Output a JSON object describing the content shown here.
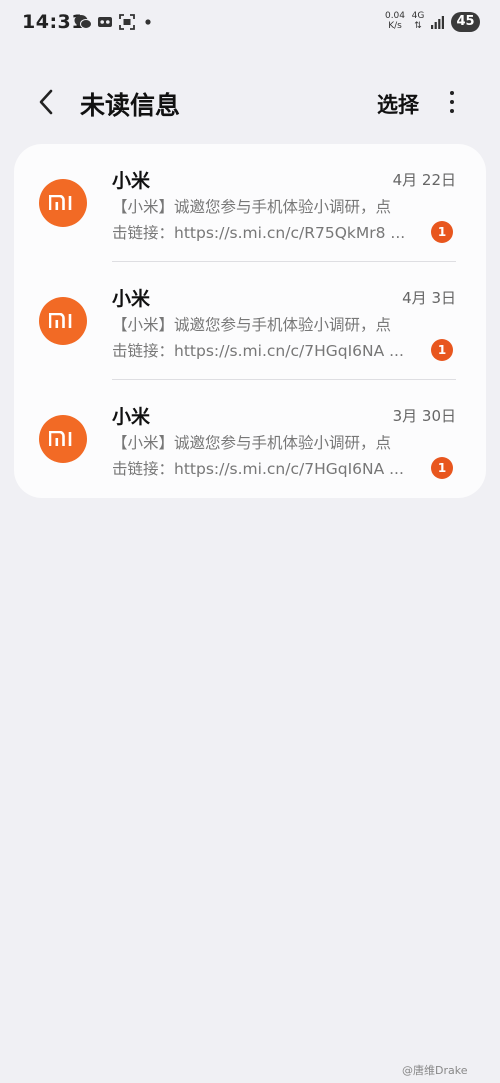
{
  "status_bar": {
    "time": "14:31",
    "icons": [
      "wechat-icon",
      "voicemail-icon",
      "screenshot-icon",
      "dot-icon",
      "signal-icon"
    ],
    "speed_value": "0.04",
    "speed_unit": "K/s",
    "network": "4G",
    "battery": "45"
  },
  "header": {
    "back_icon": "chevron-left-icon",
    "title": "未读信息",
    "select_label": "选择",
    "more_icon": "more-vertical-icon"
  },
  "brand_color": "#f26a25",
  "badge_color": "#e8561e",
  "messages": [
    {
      "sender": "小米",
      "date": "4月 22日",
      "preview_line1": "【小米】诚邀您参与手机体验小调研，点",
      "preview_line2": "击链接：https://s.mi.cn/c/R75QkMr8 ...",
      "unread_count": "1"
    },
    {
      "sender": "小米",
      "date": "4月 3日",
      "preview_line1": "【小米】诚邀您参与手机体验小调研，点",
      "preview_line2": "击链接：https://s.mi.cn/c/7HGqI6NA ...",
      "unread_count": "1"
    },
    {
      "sender": "小米",
      "date": "3月 30日",
      "preview_line1": "【小米】诚邀您参与手机体验小调研，点",
      "preview_line2": "击链接：https://s.mi.cn/c/7HGqI6NA ...",
      "unread_count": "1"
    }
  ],
  "watermark": "@唐维Drake"
}
